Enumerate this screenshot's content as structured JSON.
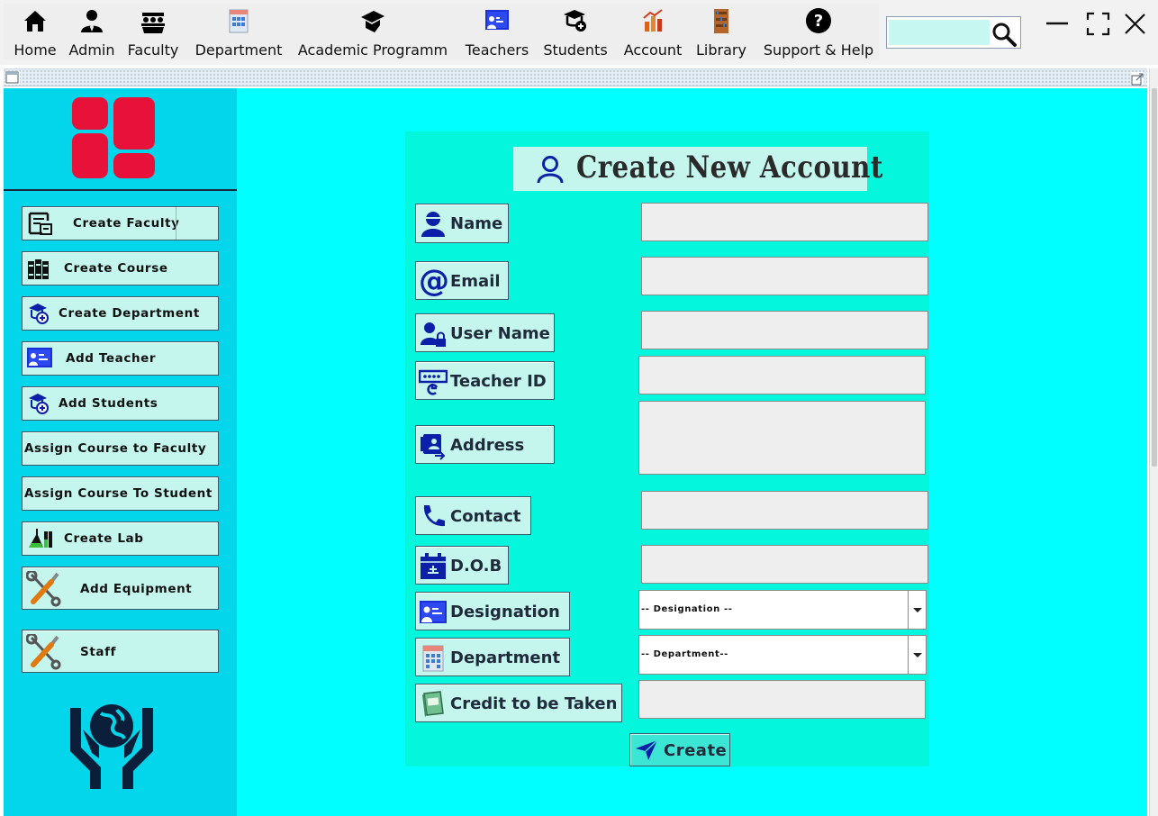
{
  "toolbar": {
    "nav_items": [
      {
        "label": "Home",
        "icon": "home-icon"
      },
      {
        "label": "Admin",
        "icon": "admin-icon"
      },
      {
        "label": "Faculty",
        "icon": "faculty-icon"
      },
      {
        "label": "Department",
        "icon": "department-icon"
      },
      {
        "label": "Academic Programm",
        "icon": "graduation-cap-icon"
      },
      {
        "label": "Teachers",
        "icon": "teacher-board-icon"
      },
      {
        "label": "Students",
        "icon": "student-add-icon"
      },
      {
        "label": "Account",
        "icon": "account-chart-icon"
      },
      {
        "label": "Library",
        "icon": "library-icon"
      },
      {
        "label": "Support & Help",
        "icon": "help-icon"
      }
    ],
    "search": {
      "value": "",
      "placeholder": ""
    }
  },
  "sidebar": {
    "items": [
      {
        "label": "Create Faculty",
        "icon": "faculty-building-icon"
      },
      {
        "label": "Create Course",
        "icon": "books-icon"
      },
      {
        "label": "Create Department",
        "icon": "department-add-icon"
      },
      {
        "label": "Add Teacher",
        "icon": "teacher-board-icon"
      },
      {
        "label": "Add Students",
        "icon": "student-add-icon"
      },
      {
        "label": "Assign Course to Faculty",
        "icon": ""
      },
      {
        "label": "Assign Course To Student",
        "icon": ""
      },
      {
        "label": "Create  Lab",
        "icon": "lab-flask-icon"
      },
      {
        "label": "Add Equipment",
        "icon": "tools-icon"
      },
      {
        "label": "Staff",
        "icon": "tools-icon"
      }
    ]
  },
  "form": {
    "title": "Create New Account",
    "fields": [
      {
        "label": "Name",
        "icon": "person-icon",
        "value": ""
      },
      {
        "label": "Email",
        "icon": "at-icon",
        "value": ""
      },
      {
        "label": "User Name",
        "icon": "user-lock-icon",
        "value": ""
      },
      {
        "label": "Teacher ID",
        "icon": "id-keypad-icon",
        "value": ""
      },
      {
        "label": "Address",
        "icon": "address-book-icon",
        "value": ""
      },
      {
        "label": "Contact",
        "icon": "phone-icon",
        "value": ""
      },
      {
        "label": "D.O.B",
        "icon": "calendar-icon",
        "value": ""
      },
      {
        "label": "Designation",
        "icon": "teacher-board-icon",
        "value": "-- Designation --"
      },
      {
        "label": "Department",
        "icon": "department-icon",
        "value": "-- Department--"
      },
      {
        "label": "Credit to be Taken",
        "icon": "notebook-icon",
        "value": ""
      }
    ],
    "submit_label": "Create"
  },
  "colors": {
    "content_bg": "#00ffff",
    "sidebar_bg": "#03d5eb",
    "form_bg": "#04f7dc",
    "button_bg": "#c4f6ee",
    "logo_red": "#e8113a",
    "icon_navy": "#0b1fa8"
  }
}
